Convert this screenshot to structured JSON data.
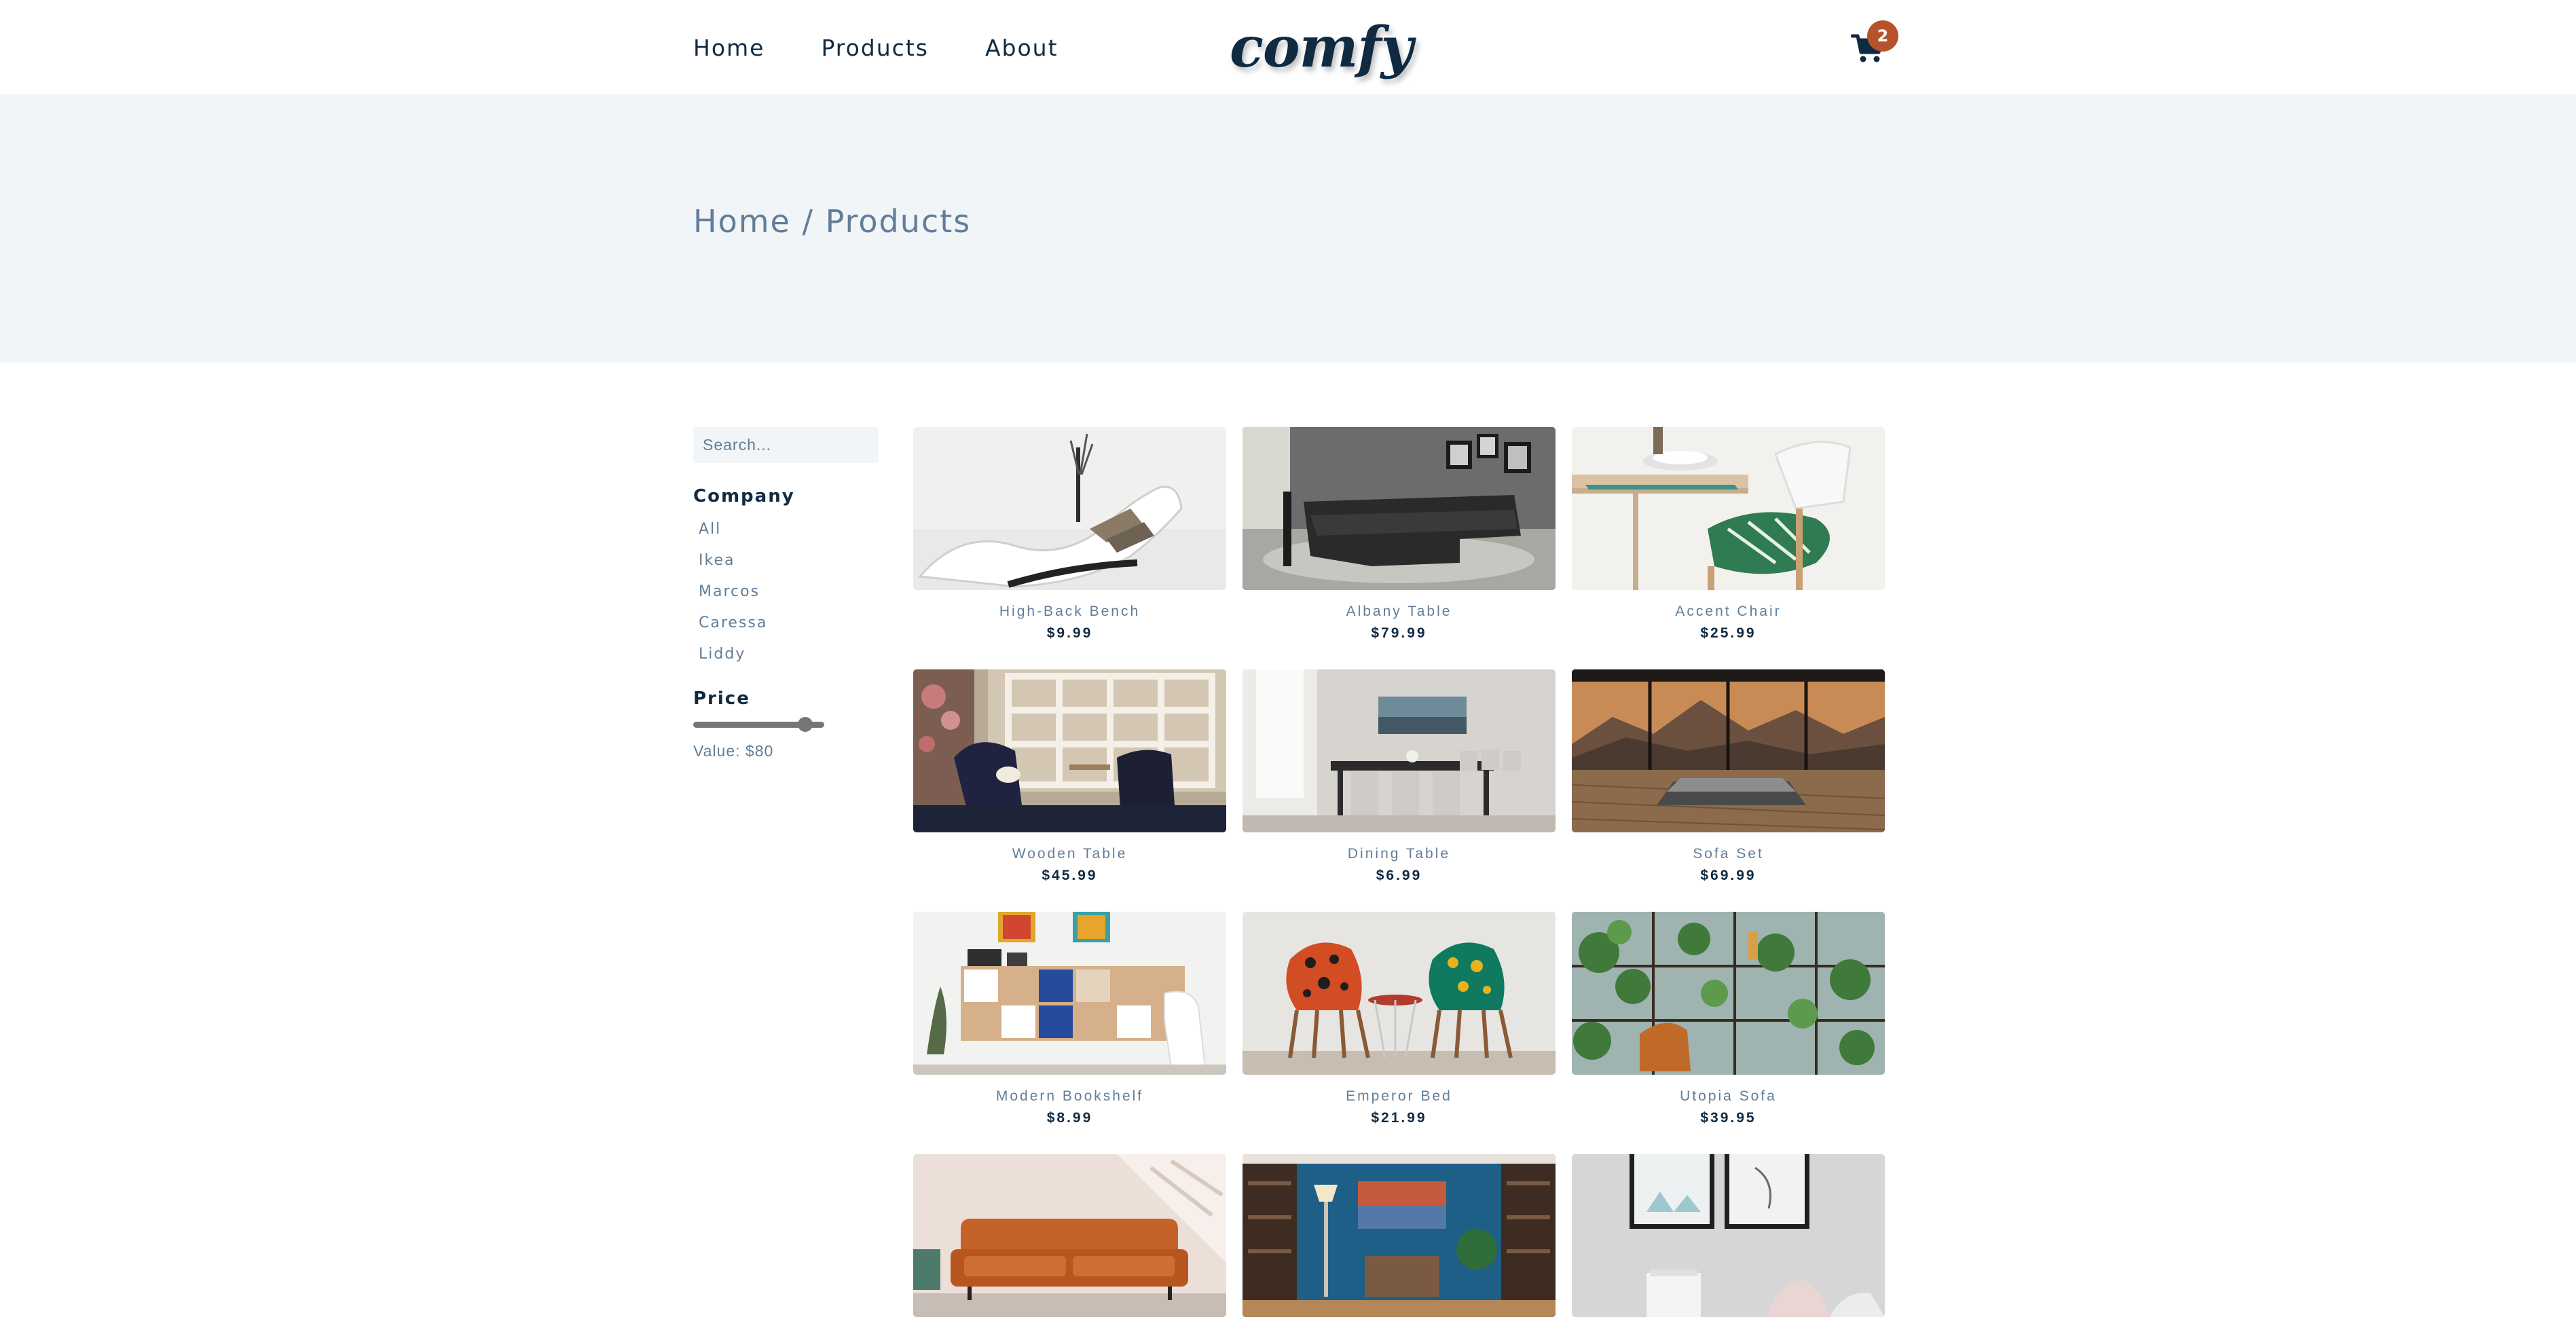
{
  "nav": {
    "links": [
      "Home",
      "Products",
      "About"
    ],
    "logo": "comfy",
    "cart_count": "2"
  },
  "hero": {
    "breadcrumb": "Home / Products"
  },
  "filters": {
    "search_placeholder": "Search...",
    "company_heading": "Company",
    "companies": [
      "All",
      "Ikea",
      "Marcos",
      "Caressa",
      "Liddy"
    ],
    "price_heading": "Price",
    "price_fraction": 0.9,
    "price_value_text": "Value: $80"
  },
  "colors": {
    "primary_text": "#102a42",
    "secondary_text": "#617d98",
    "hero_bg": "#f1f5f8",
    "badge": "#b5542c"
  },
  "products": [
    {
      "name": "High-Back Bench",
      "price": "$9.99",
      "image": "white-chaise-lounge"
    },
    {
      "name": "Albany Table",
      "price": "$79.99",
      "image": "dark-sectional-sofa"
    },
    {
      "name": "Accent Chair",
      "price": "$25.99",
      "image": "dining-chair-leaf-cushion"
    },
    {
      "name": "Wooden Table",
      "price": "$45.99",
      "image": "shelving-armchairs-room"
    },
    {
      "name": "Dining Table",
      "price": "$6.99",
      "image": "dining-room-table"
    },
    {
      "name": "Sofa Set",
      "price": "$69.99",
      "image": "bed-panoramic-window"
    },
    {
      "name": "Modern Bookshelf",
      "price": "$8.99",
      "image": "cube-bookshelf"
    },
    {
      "name": "Emperor Bed",
      "price": "$21.99",
      "image": "two-patterned-chairs"
    },
    {
      "name": "Utopia Sofa",
      "price": "$39.95",
      "image": "plants-shelving"
    },
    {
      "name": "",
      "price": "",
      "image": "orange-leather-sofa"
    },
    {
      "name": "",
      "price": "",
      "image": "blue-wall-living-room"
    },
    {
      "name": "",
      "price": "",
      "image": "framed-prints-wall"
    }
  ]
}
